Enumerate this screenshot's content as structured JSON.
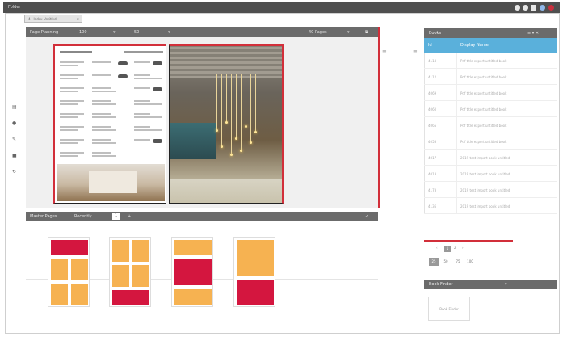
{
  "window": {
    "title": "Folder",
    "icons": [
      "refresh-icon",
      "info-icon",
      "grid-icon",
      "user-icon",
      "close-icon"
    ]
  },
  "tab": {
    "label": "4 - Index Untitled",
    "close": "×"
  },
  "left_toolbar": [
    "layers-icon",
    "settings-icon",
    "wrench-icon",
    "save-icon",
    "refresh-icon"
  ],
  "page_planning": {
    "label": "Page Planning",
    "field1": "100",
    "field2": "50",
    "pages_label": "40 Pages",
    "right_icon": "⧉"
  },
  "master_pages": {
    "label": "Master Pages",
    "mode": "Recently",
    "page": "1",
    "add": "+",
    "check": "✓"
  },
  "books": {
    "header": "Books",
    "header_icons": "≡ ▾ ✕",
    "col_id": "Id",
    "col_name": "Display Name",
    "rows": [
      {
        "id": "4113",
        "name": "Pdf title export untitled book"
      },
      {
        "id": "4112",
        "name": "Pdf title export untitled book"
      },
      {
        "id": "4069",
        "name": "Pdf title export untitled book"
      },
      {
        "id": "4060",
        "name": "Pdf title export untitled book"
      },
      {
        "id": "4065",
        "name": "Pdf title export untitled book"
      },
      {
        "id": "4053",
        "name": "Pdf title export untitled book"
      },
      {
        "id": "4017",
        "name": "2019 test import book untitled"
      },
      {
        "id": "4013",
        "name": "2019 test import book untitled"
      },
      {
        "id": "4173",
        "name": "2019 test import book untitled"
      },
      {
        "id": "4136",
        "name": "2019 test import book untitled"
      }
    ],
    "pager": {
      "prev": "‹",
      "current": "1",
      "next": "2",
      "last": "›"
    },
    "page_buttons": [
      "25",
      "50",
      "75",
      "100"
    ]
  },
  "book_finder": {
    "header": "Book Finder",
    "box_label": "Book Finder"
  },
  "colors": {
    "accent_red": "#d22f3a",
    "master_orange": "#f6b251",
    "master_red": "#d4163f",
    "table_blue": "#5ab0db"
  }
}
